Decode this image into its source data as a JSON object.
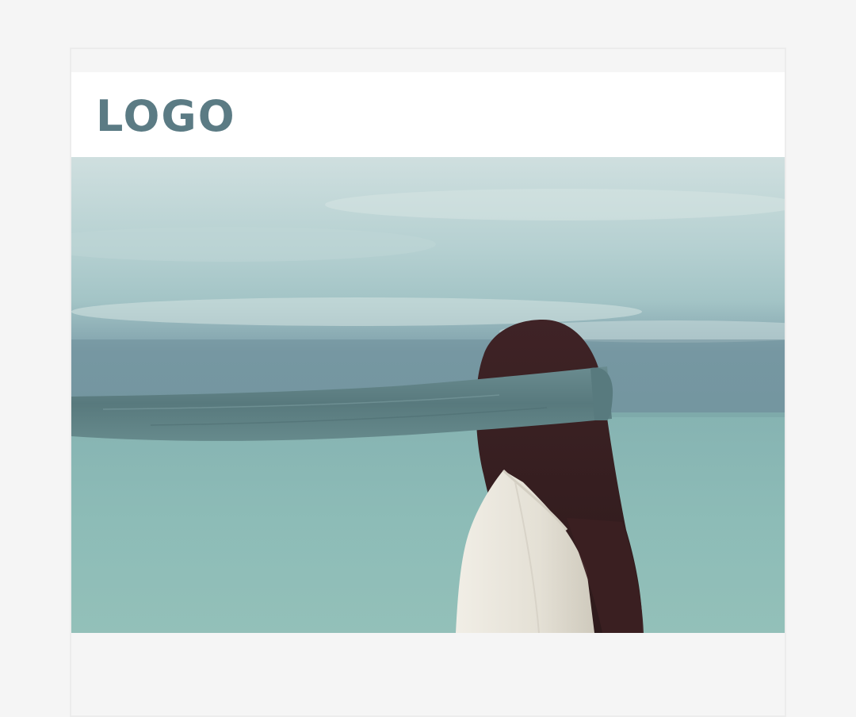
{
  "header": {
    "logo_text": "LOGO"
  },
  "hero": {
    "image_subject": "woman-blindfolded-by-sea",
    "colors": {
      "sky_top": "#cbdcdc",
      "sky_mid": "#9fc1c4",
      "cloud_band": "#6d8f9c",
      "sea": "#8fbcb7",
      "sea_deep": "#7fb0ab",
      "blindfold": "#5e7e82",
      "hair": "#3a2223",
      "jacket": "#e8e4da"
    }
  },
  "theme": {
    "page_bg": "#f5f5f5",
    "card_border": "#ececec",
    "header_bg": "#ffffff",
    "logo_color": "#5b7b84"
  }
}
